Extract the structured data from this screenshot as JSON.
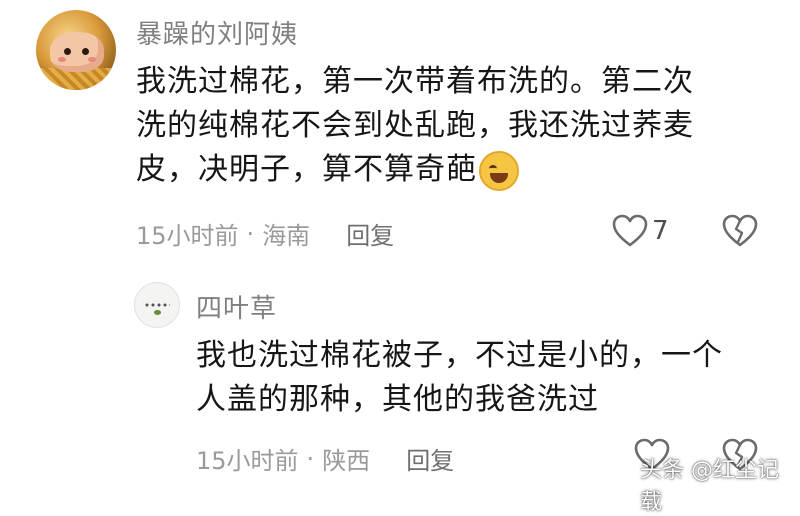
{
  "comment": {
    "username": "暴躁的刘阿姨",
    "text_lines": [
      "我洗过棉花，第一次带着布洗的。第二次",
      "洗的纯棉花不会到处乱跑，我还洗过荞麦",
      "皮，决明子，算不算奇葩"
    ],
    "time": "15小时前",
    "separator": "·",
    "location": "海南",
    "reply_label": "回复",
    "like_count": "7"
  },
  "reply": {
    "username": "四叶草",
    "text_lines": [
      "我也洗过棉花被子，不过是小的，一个",
      "人盖的那种，其他的我爸洗过"
    ],
    "time": "15小时前",
    "separator": "·",
    "location": "陕西",
    "reply_label": "回复"
  },
  "watermark": {
    "text": "头条 @红尘记载"
  },
  "icons": {
    "like": "heart-outline-icon",
    "dislike": "broken-heart-icon",
    "emoji": "laughing-tears-emoji-icon"
  },
  "colors": {
    "text": "#161616",
    "muted": "#9a9a9a",
    "username": "#7f7f7f"
  }
}
